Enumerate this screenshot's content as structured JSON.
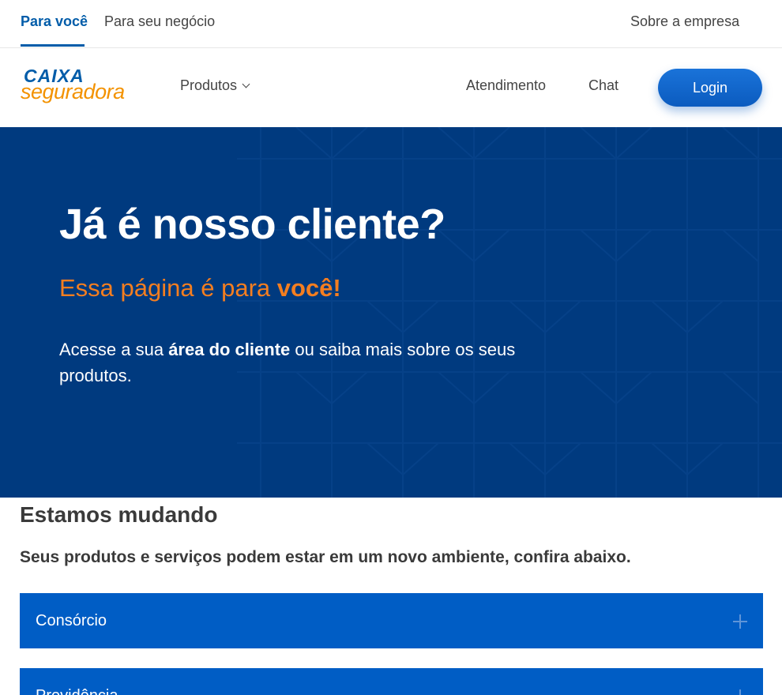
{
  "topbar": {
    "tabs": [
      {
        "label": "Para você",
        "active": true
      },
      {
        "label": "Para seu negócio",
        "active": false
      }
    ],
    "right_link": "Sobre a empresa"
  },
  "nav": {
    "logo_line1": "CAIXA",
    "logo_line2": "seguradora",
    "produtos": "Produtos",
    "atendimento": "Atendimento",
    "chat": "Chat",
    "login": "Login"
  },
  "hero": {
    "title": "Já é nosso cliente?",
    "subtitle_prefix": "Essa página é para ",
    "subtitle_bold": "você!",
    "desc_prefix": "Acesse a sua ",
    "desc_bold": "área do cliente",
    "desc_suffix": " ou saiba mais sobre os seus produtos."
  },
  "content": {
    "heading": "Estamos mudando",
    "lead": "Seus produtos e serviços podem estar em um novo ambiente, confira abaixo.",
    "accordions": [
      {
        "label": "Consórcio"
      },
      {
        "label": "Previdência"
      }
    ]
  },
  "colors": {
    "brand_blue": "#005ca9",
    "hero_bg": "#003a7f",
    "accent_orange": "#f47e20",
    "accordion_bg": "#005dc5"
  }
}
